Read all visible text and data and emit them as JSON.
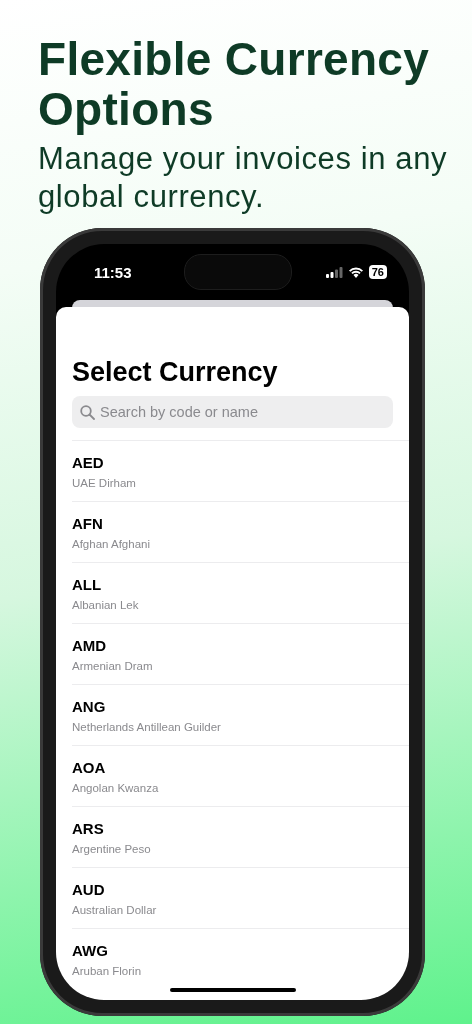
{
  "headline": "Flexible Currency Options",
  "subtitle": "Manage your invoices in any global currency.",
  "status_bar": {
    "time": "11:53",
    "battery": "76"
  },
  "sheet": {
    "title": "Select Currency",
    "search": {
      "placeholder": "Search by code or name"
    }
  },
  "currencies": [
    {
      "code": "AED",
      "name": "UAE Dirham"
    },
    {
      "code": "AFN",
      "name": "Afghan Afghani"
    },
    {
      "code": "ALL",
      "name": "Albanian Lek"
    },
    {
      "code": "AMD",
      "name": "Armenian Dram"
    },
    {
      "code": "ANG",
      "name": "Netherlands Antillean Guilder"
    },
    {
      "code": "AOA",
      "name": "Angolan Kwanza"
    },
    {
      "code": "ARS",
      "name": "Argentine Peso"
    },
    {
      "code": "AUD",
      "name": "Australian Dollar"
    },
    {
      "code": "AWG",
      "name": "Aruban Florin"
    }
  ]
}
